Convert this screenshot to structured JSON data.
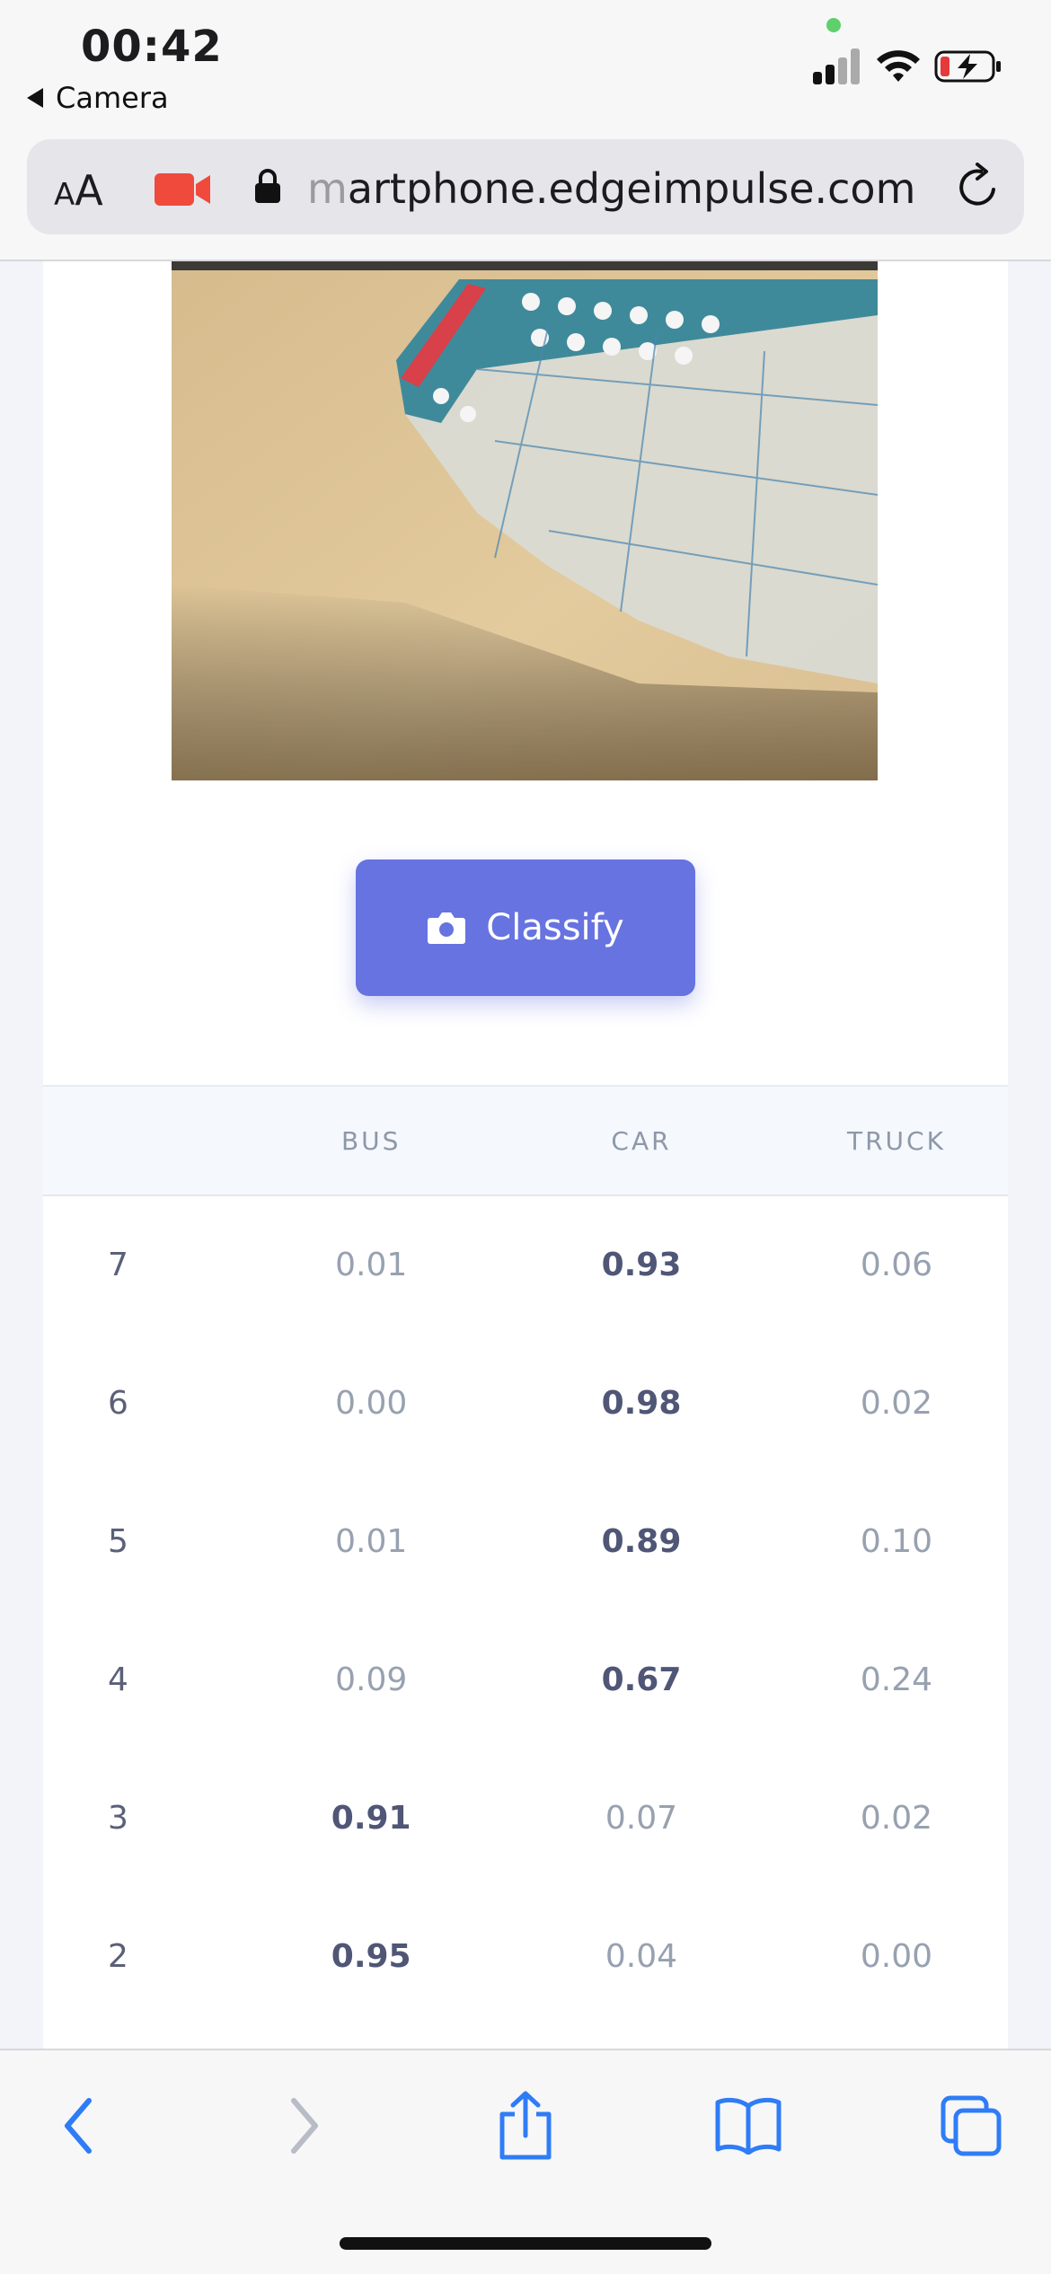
{
  "status_bar": {
    "time": "00:42",
    "back_app": "Camera",
    "icons": [
      "microphone-dot",
      "cellular-signal",
      "wifi",
      "battery-charging"
    ]
  },
  "browser": {
    "text_size_label_small": "A",
    "text_size_label_large": "A",
    "url_fade": "m",
    "url_main": "artphone.edgeimpulse.com",
    "icons": [
      "camera-recording-icon",
      "lock-icon",
      "reload-icon"
    ]
  },
  "classify_button": {
    "label": "Classify",
    "icon": "camera-icon",
    "color": "#6773e0"
  },
  "results": {
    "columns": [
      "",
      "BUS",
      "CAR",
      "TRUCK"
    ],
    "rows": [
      {
        "index": "7",
        "bus": "0.01",
        "car": "0.93",
        "truck": "0.06",
        "best": "car"
      },
      {
        "index": "6",
        "bus": "0.00",
        "car": "0.98",
        "truck": "0.02",
        "best": "car"
      },
      {
        "index": "5",
        "bus": "0.01",
        "car": "0.89",
        "truck": "0.10",
        "best": "car"
      },
      {
        "index": "4",
        "bus": "0.09",
        "car": "0.67",
        "truck": "0.24",
        "best": "car"
      },
      {
        "index": "3",
        "bus": "0.91",
        "car": "0.07",
        "truck": "0.02",
        "best": "bus"
      },
      {
        "index": "2",
        "bus": "0.95",
        "car": "0.04",
        "truck": "0.00",
        "best": "bus"
      }
    ]
  },
  "toolbar": {
    "items": [
      "back-icon",
      "forward-icon",
      "share-icon",
      "bookmarks-icon",
      "tabs-icon"
    ],
    "accent": "#2f7cf6"
  }
}
